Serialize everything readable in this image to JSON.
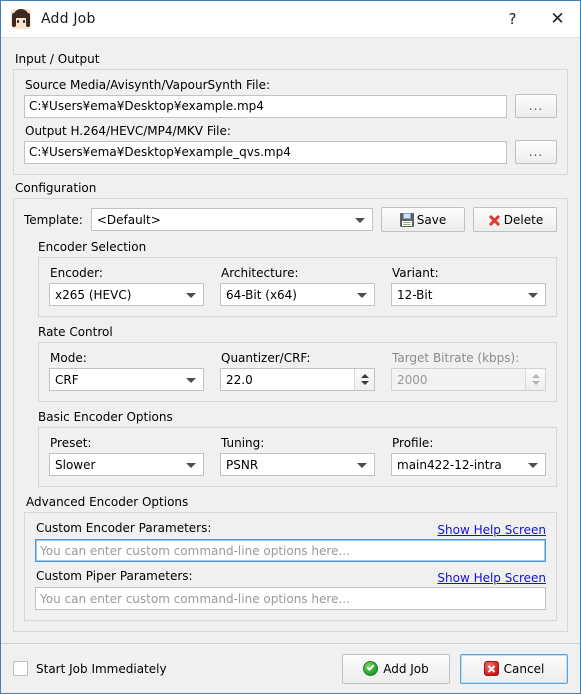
{
  "window": {
    "title": "Add Job",
    "icon": "app-avatar-icon",
    "help_label": "?",
    "close_label": "✕",
    "accent": "#3f7fb5",
    "background": "#f0f0f0"
  },
  "input_output": {
    "section_title": "Input / Output",
    "source": {
      "label": "Source Media/Avisynth/VapourSynth File:",
      "value": "C:¥Users¥ema¥Desktop¥example.mp4",
      "browse_label": "..."
    },
    "output": {
      "label": "Output H.264/HEVC/MP4/MKV File:",
      "value": "C:¥Users¥ema¥Desktop¥example_qvs.mp4",
      "browse_label": "..."
    }
  },
  "configuration": {
    "section_title": "Configuration",
    "template": {
      "label": "Template:",
      "value": "<Default>",
      "save_label": "Save",
      "save_icon": "floppy-disk-icon",
      "delete_label": "Delete",
      "delete_icon": "red-x-icon"
    },
    "encoder_selection": {
      "section_title": "Encoder Selection",
      "encoder": {
        "label": "Encoder:",
        "value": "x265 (HEVC)"
      },
      "architecture": {
        "label": "Architecture:",
        "value": "64-Bit (x64)"
      },
      "variant": {
        "label": "Variant:",
        "value": "12-Bit"
      }
    },
    "rate_control": {
      "section_title": "Rate Control",
      "mode": {
        "label": "Mode:",
        "value": "CRF"
      },
      "quantizer": {
        "label": "Quantizer/CRF:",
        "value": "22.0",
        "enabled": true
      },
      "target_bitrate": {
        "label": "Target Bitrate (kbps):",
        "value": "2000",
        "enabled": false
      }
    },
    "basic_options": {
      "section_title": "Basic Encoder Options",
      "preset": {
        "label": "Preset:",
        "value": "Slower"
      },
      "tuning": {
        "label": "Tuning:",
        "value": "PSNR"
      },
      "profile": {
        "label": "Profile:",
        "value": "main422-12-intra"
      }
    },
    "advanced_options": {
      "section_title": "Advanced Encoder Options",
      "encoder_params": {
        "label": "Custom Encoder Parameters:",
        "value": "",
        "placeholder": "You can enter custom command-line options here...",
        "help_link": "Show Help Screen"
      },
      "piper_params": {
        "label": "Custom Piper Parameters:",
        "value": "",
        "placeholder": "You can enter custom command-line options here...",
        "help_link": "Show Help Screen"
      }
    }
  },
  "footer": {
    "start_immediately_label": "Start Job Immediately",
    "start_immediately_checked": false,
    "add_job_label": "Add Job",
    "add_job_icon": "green-check-icon",
    "cancel_label": "Cancel",
    "cancel_icon": "red-x-circle-icon"
  }
}
